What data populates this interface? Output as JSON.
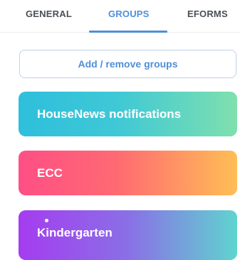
{
  "tabs": [
    {
      "label": "GENERAL",
      "active": false
    },
    {
      "label": "GROUPS",
      "active": true
    },
    {
      "label": "EFORMS",
      "active": false
    }
  ],
  "add_button": {
    "label": "Add / remove groups"
  },
  "groups": [
    {
      "name": "HouseNews notifications",
      "gradient": [
        "#2ebfdc",
        "#7fe0ae"
      ]
    },
    {
      "name": "ECC",
      "gradient": [
        "#ff4f86",
        "#ffbe55"
      ]
    },
    {
      "name": "Kindergarten",
      "gradient": [
        "#a53cf0",
        "#5fd4cf"
      ],
      "has_unread_dot": true
    }
  ],
  "colors": {
    "accent": "#4e8fd8",
    "tab_text": "#4a4f57",
    "divider": "#eceef1"
  }
}
